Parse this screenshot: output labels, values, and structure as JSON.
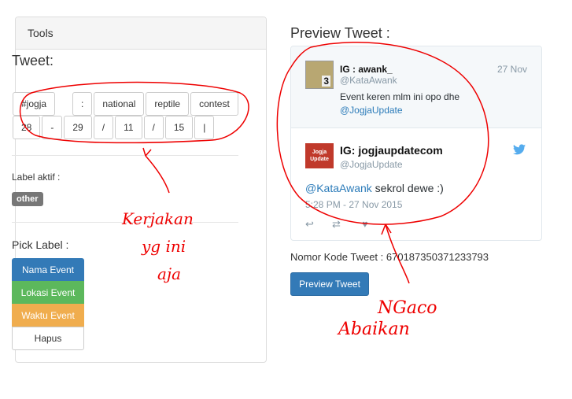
{
  "tools": {
    "header": "Tools",
    "tweet_label": "Tweet:",
    "chips_row1": [
      "#jogja",
      ":",
      "national",
      "reptile",
      "contest"
    ],
    "chips_row2": [
      "28",
      "-",
      "29",
      "/",
      "11",
      "/",
      "15",
      "|"
    ],
    "label_aktif": "Label aktif :",
    "badge": "other",
    "pick_label": "Pick Label :",
    "pick_buttons": {
      "nama": "Nama Event",
      "lokasi": "Lokasi Event",
      "waktu": "Waktu Event",
      "hapus": "Hapus"
    }
  },
  "preview": {
    "title": "Preview Tweet :",
    "quoted": {
      "name": "IG : awank_",
      "handle": "@KataAwank",
      "date": "27 Nov",
      "text": "Event keren mlm ini opo dhe",
      "mention": "@JogjaUpdate",
      "avatar_num": "3"
    },
    "tweet": {
      "name": "IG: jogjaupdatecom",
      "handle": "@JogjaUpdate",
      "mention": "@KataAwank",
      "text": " sekrol dewe :)",
      "time": "5:28 PM - 27 Nov 2015",
      "avatar_text": "Jogja Update"
    },
    "kode": "Nomor Kode Tweet : 670187350371233793",
    "button": "Preview Tweet"
  },
  "annotations": {
    "left": [
      "Kerjakan",
      "yg ini",
      "aja"
    ],
    "right": [
      "NGaco",
      "Abaikan"
    ]
  },
  "colors": {
    "primary": "#337ab7",
    "success": "#5cb85c",
    "warning": "#f0ad4e",
    "annotation": "#ee0000"
  }
}
